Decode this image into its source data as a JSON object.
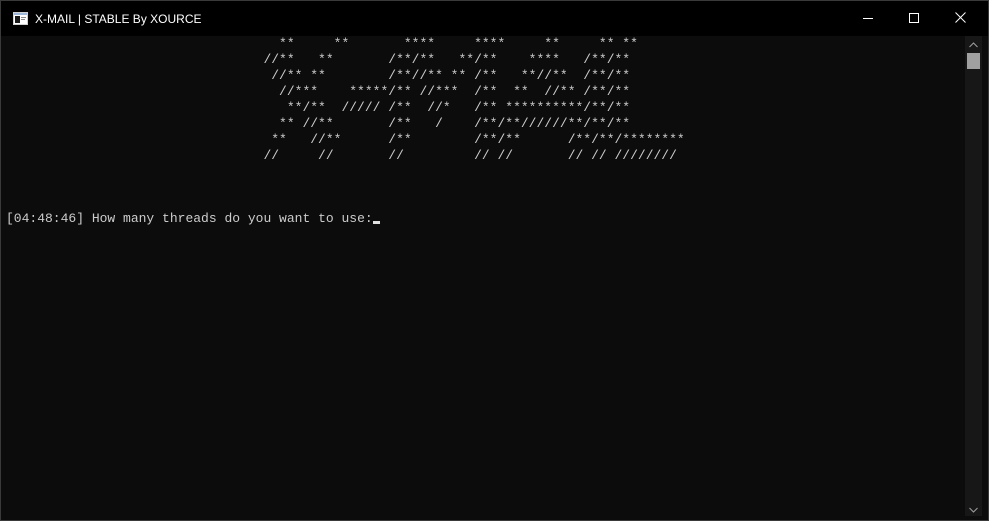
{
  "window": {
    "title": "X-MAIL | STABLE By XOURCE",
    "icons": {
      "app": "console-window-icon",
      "minimize": "minimize-icon",
      "maximize": "maximize-icon",
      "close": "close-icon"
    }
  },
  "console": {
    "banner_lines": [
      "                                   **     **       ****     ****     **     ** **",
      "                                 //**   **       /**/**   **/**    ****   /**/**",
      "                                  //** **        /**//** ** /**   **//**  /**/**",
      "                                   //***    *****/** //***  /**  **  //** /**/**",
      "                                    **/**  ///// /**  //*   /** **********/**/**",
      "                                   ** //**       /**   /    /**/**//////**/**/**",
      "                                  **   //**      /**        /**/**      /**/**/********",
      "                                 //     //       //         // //       // // ////////"
    ],
    "timestamp": "[04:48:46]",
    "prompt": "How many threads do you want to use:"
  },
  "scrollbar": {
    "position": 0,
    "icons": {
      "up": "scroll-up-arrow-icon",
      "down": "scroll-down-arrow-icon"
    }
  },
  "colors": {
    "console_bg": "#0c0c0c",
    "console_text": "#cccccc",
    "titlebar_bg": "#000000"
  }
}
